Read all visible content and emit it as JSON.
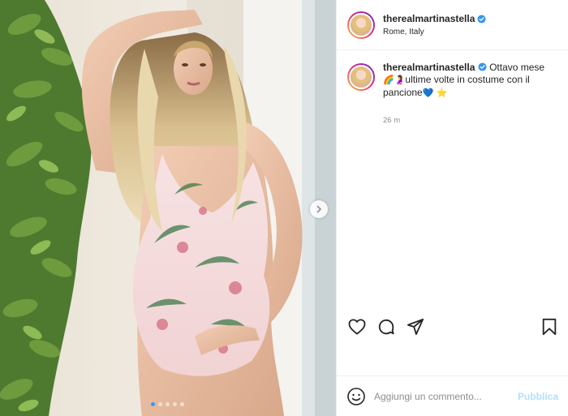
{
  "post": {
    "image_alt_icon": "photo",
    "carousel_dots": 5,
    "carousel_active_index": 0
  },
  "header": {
    "username": "therealmartinastella",
    "location": "Rome, Italy",
    "verified_icon": "verified-badge-icon"
  },
  "caption": {
    "username": "therealmartinastella",
    "text_line1": "Ottavo mese",
    "emoji_rainbow": "🌈",
    "emoji_pregnant": "🤰",
    "text_line2": "ultime volte in costume con il pancione",
    "emoji_heart": "💙",
    "emoji_star": "⭐",
    "time": "26 m"
  },
  "actions": {
    "like_icon": "heart-icon",
    "comment_icon": "comment-icon",
    "share_icon": "share-icon",
    "save_icon": "bookmark-icon"
  },
  "comment_box": {
    "placeholder": "Aggiungi un commento...",
    "publish_label": "Pubblica"
  },
  "colors": {
    "verified": "#3897f0",
    "publish_disabled": "#b2dffc",
    "muted_text": "#8e8e8e"
  }
}
